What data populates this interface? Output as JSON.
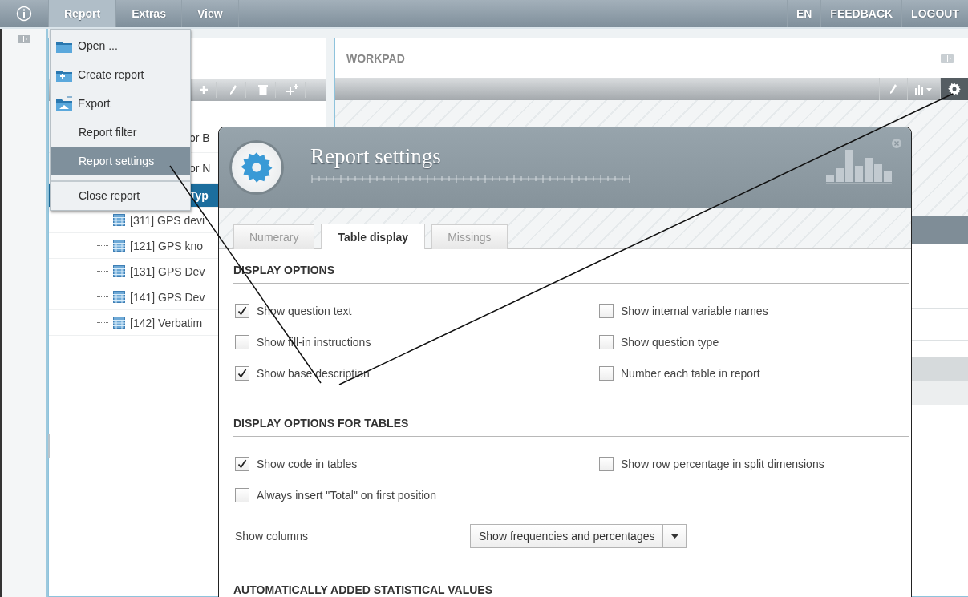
{
  "menubar": {
    "items": [
      {
        "label": "Report",
        "selected": true
      },
      {
        "label": "Extras",
        "selected": false
      },
      {
        "label": "View",
        "selected": false
      }
    ],
    "right_items": [
      "EN",
      "FEEDBACK",
      "LOGOUT"
    ]
  },
  "menu": {
    "items": [
      {
        "label": "Open ...",
        "kind": "open",
        "selected": false
      },
      {
        "label": "Create report",
        "kind": "create",
        "selected": false
      },
      {
        "label": "Export",
        "kind": "export",
        "selected": false
      },
      {
        "label": "Report filter",
        "kind": "text",
        "selected": false
      },
      {
        "label": "Report settings",
        "kind": "text",
        "selected": true
      },
      {
        "label": "Close report",
        "kind": "text",
        "selected": false,
        "divider_above": true
      }
    ]
  },
  "tree": [
    {
      "label": "or B",
      "selected": false
    },
    {
      "label": "or N",
      "selected": false
    },
    {
      "label": "Typ",
      "selected": true,
      "children": [
        {
          "label": "[311] GPS devi",
          "selected": false
        },
        {
          "label": "[121] GPS kno",
          "selected": false
        },
        {
          "label": "[131] GPS Dev",
          "selected": false
        },
        {
          "label": "[141] GPS Dev",
          "selected": false
        },
        {
          "label": "[142] Verbatim",
          "selected": false
        }
      ]
    }
  ],
  "workpad": {
    "title": "WORKPAD"
  },
  "dialog": {
    "title": "Report settings",
    "tabs": [
      {
        "label": "Numerary",
        "selected": false
      },
      {
        "label": "Table display",
        "selected": true
      },
      {
        "label": "Missings",
        "selected": false
      }
    ],
    "sections": [
      {
        "heading": "DISPLAY OPTIONS",
        "options": [
          {
            "label": "Show question text",
            "checked": true
          },
          {
            "label": "Show internal variable names",
            "checked": false
          },
          {
            "label": "Show fill-in instructions",
            "checked": false
          },
          {
            "label": "Show question type",
            "checked": false
          },
          {
            "label": "Show base description",
            "checked": true
          },
          {
            "label": "Number each table in report",
            "checked": false
          }
        ]
      },
      {
        "heading": "DISPLAY OPTIONS FOR TABLES",
        "options": [
          {
            "label": "Show code in tables",
            "checked": true
          },
          {
            "label": "Show row percentage in split dimensions",
            "checked": false
          },
          {
            "label": "Always insert \"Total\" on first position",
            "checked": false
          }
        ],
        "fields": [
          {
            "label": "Show columns",
            "value": "Show frequencies and percentages"
          }
        ]
      },
      {
        "heading": "AUTOMATICALLY ADDED STATISTICAL VALUES"
      }
    ]
  }
}
